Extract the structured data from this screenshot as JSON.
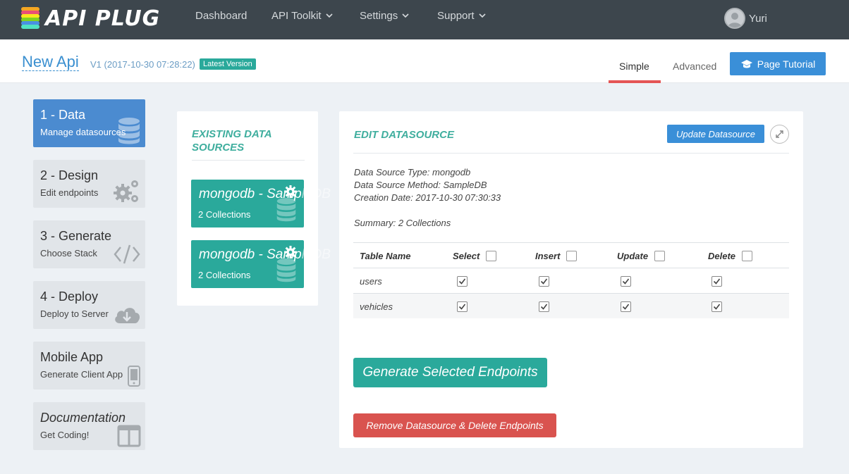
{
  "brand": {
    "name": "API PLUG"
  },
  "nav": {
    "items": [
      {
        "label": "Dashboard"
      },
      {
        "label": "API Toolkit"
      },
      {
        "label": "Settings"
      },
      {
        "label": "Support"
      }
    ],
    "user": "Yuri"
  },
  "header": {
    "api_name": "New Api",
    "version": "V1 (2017-10-30 07:28:22)",
    "badge": "Latest Version",
    "tabs": [
      {
        "label": "Simple",
        "active": true
      },
      {
        "label": "Advanced",
        "active": false
      }
    ],
    "tutorial_button": "Page Tutorial"
  },
  "steps": [
    {
      "title": "1 - Data",
      "subtitle": "Manage datasources",
      "icon": "database-icon",
      "active": true
    },
    {
      "title": "2 - Design",
      "subtitle": "Edit endpoints",
      "icon": "gears-icon",
      "active": false
    },
    {
      "title": "3 - Generate",
      "subtitle": "Choose Stack",
      "icon": "code-icon",
      "active": false
    },
    {
      "title": "4 - Deploy",
      "subtitle": "Deploy to Server",
      "icon": "cloud-download-icon",
      "active": false
    },
    {
      "title": "Mobile App",
      "subtitle": "Generate Client App",
      "icon": "mobile-icon",
      "active": false
    },
    {
      "title": "Documentation",
      "subtitle": "Get Coding!",
      "icon": "columns-icon",
      "active": false
    }
  ],
  "existing": {
    "heading": "EXISTING DATA SOURCES",
    "sources": [
      {
        "name_visible": "mongodb - Samp",
        "name_faded": "leDB",
        "count": "2 Collections"
      },
      {
        "name_visible": "mongodb - Samp",
        "name_faded": "leDB",
        "count": "2 Collections"
      }
    ]
  },
  "edit": {
    "heading": "EDIT DATASOURCE",
    "update_button": "Update Datasource",
    "type": "Data Source Type: mongodb",
    "method": "Data Source Method: SampleDB",
    "created": "Creation Date: 2017-10-30 07:30:33",
    "summary": "Summary: 2 Collections",
    "columns": [
      "Table Name",
      "Select",
      "Insert",
      "Update",
      "Delete"
    ],
    "rows": [
      {
        "name": "users",
        "select": true,
        "insert": true,
        "update": true,
        "delete": true
      },
      {
        "name": "vehicles",
        "select": true,
        "insert": true,
        "update": true,
        "delete": true
      }
    ],
    "generate_button": "Generate Selected Endpoints",
    "remove_button": "Remove Datasource & Delete Endpoints"
  },
  "colors": {
    "nav_bg": "#3d464d",
    "accent_blue": "#3a8fd8",
    "teal": "#2aa99b",
    "danger": "#d9534f",
    "tab_underline": "#e45555"
  }
}
